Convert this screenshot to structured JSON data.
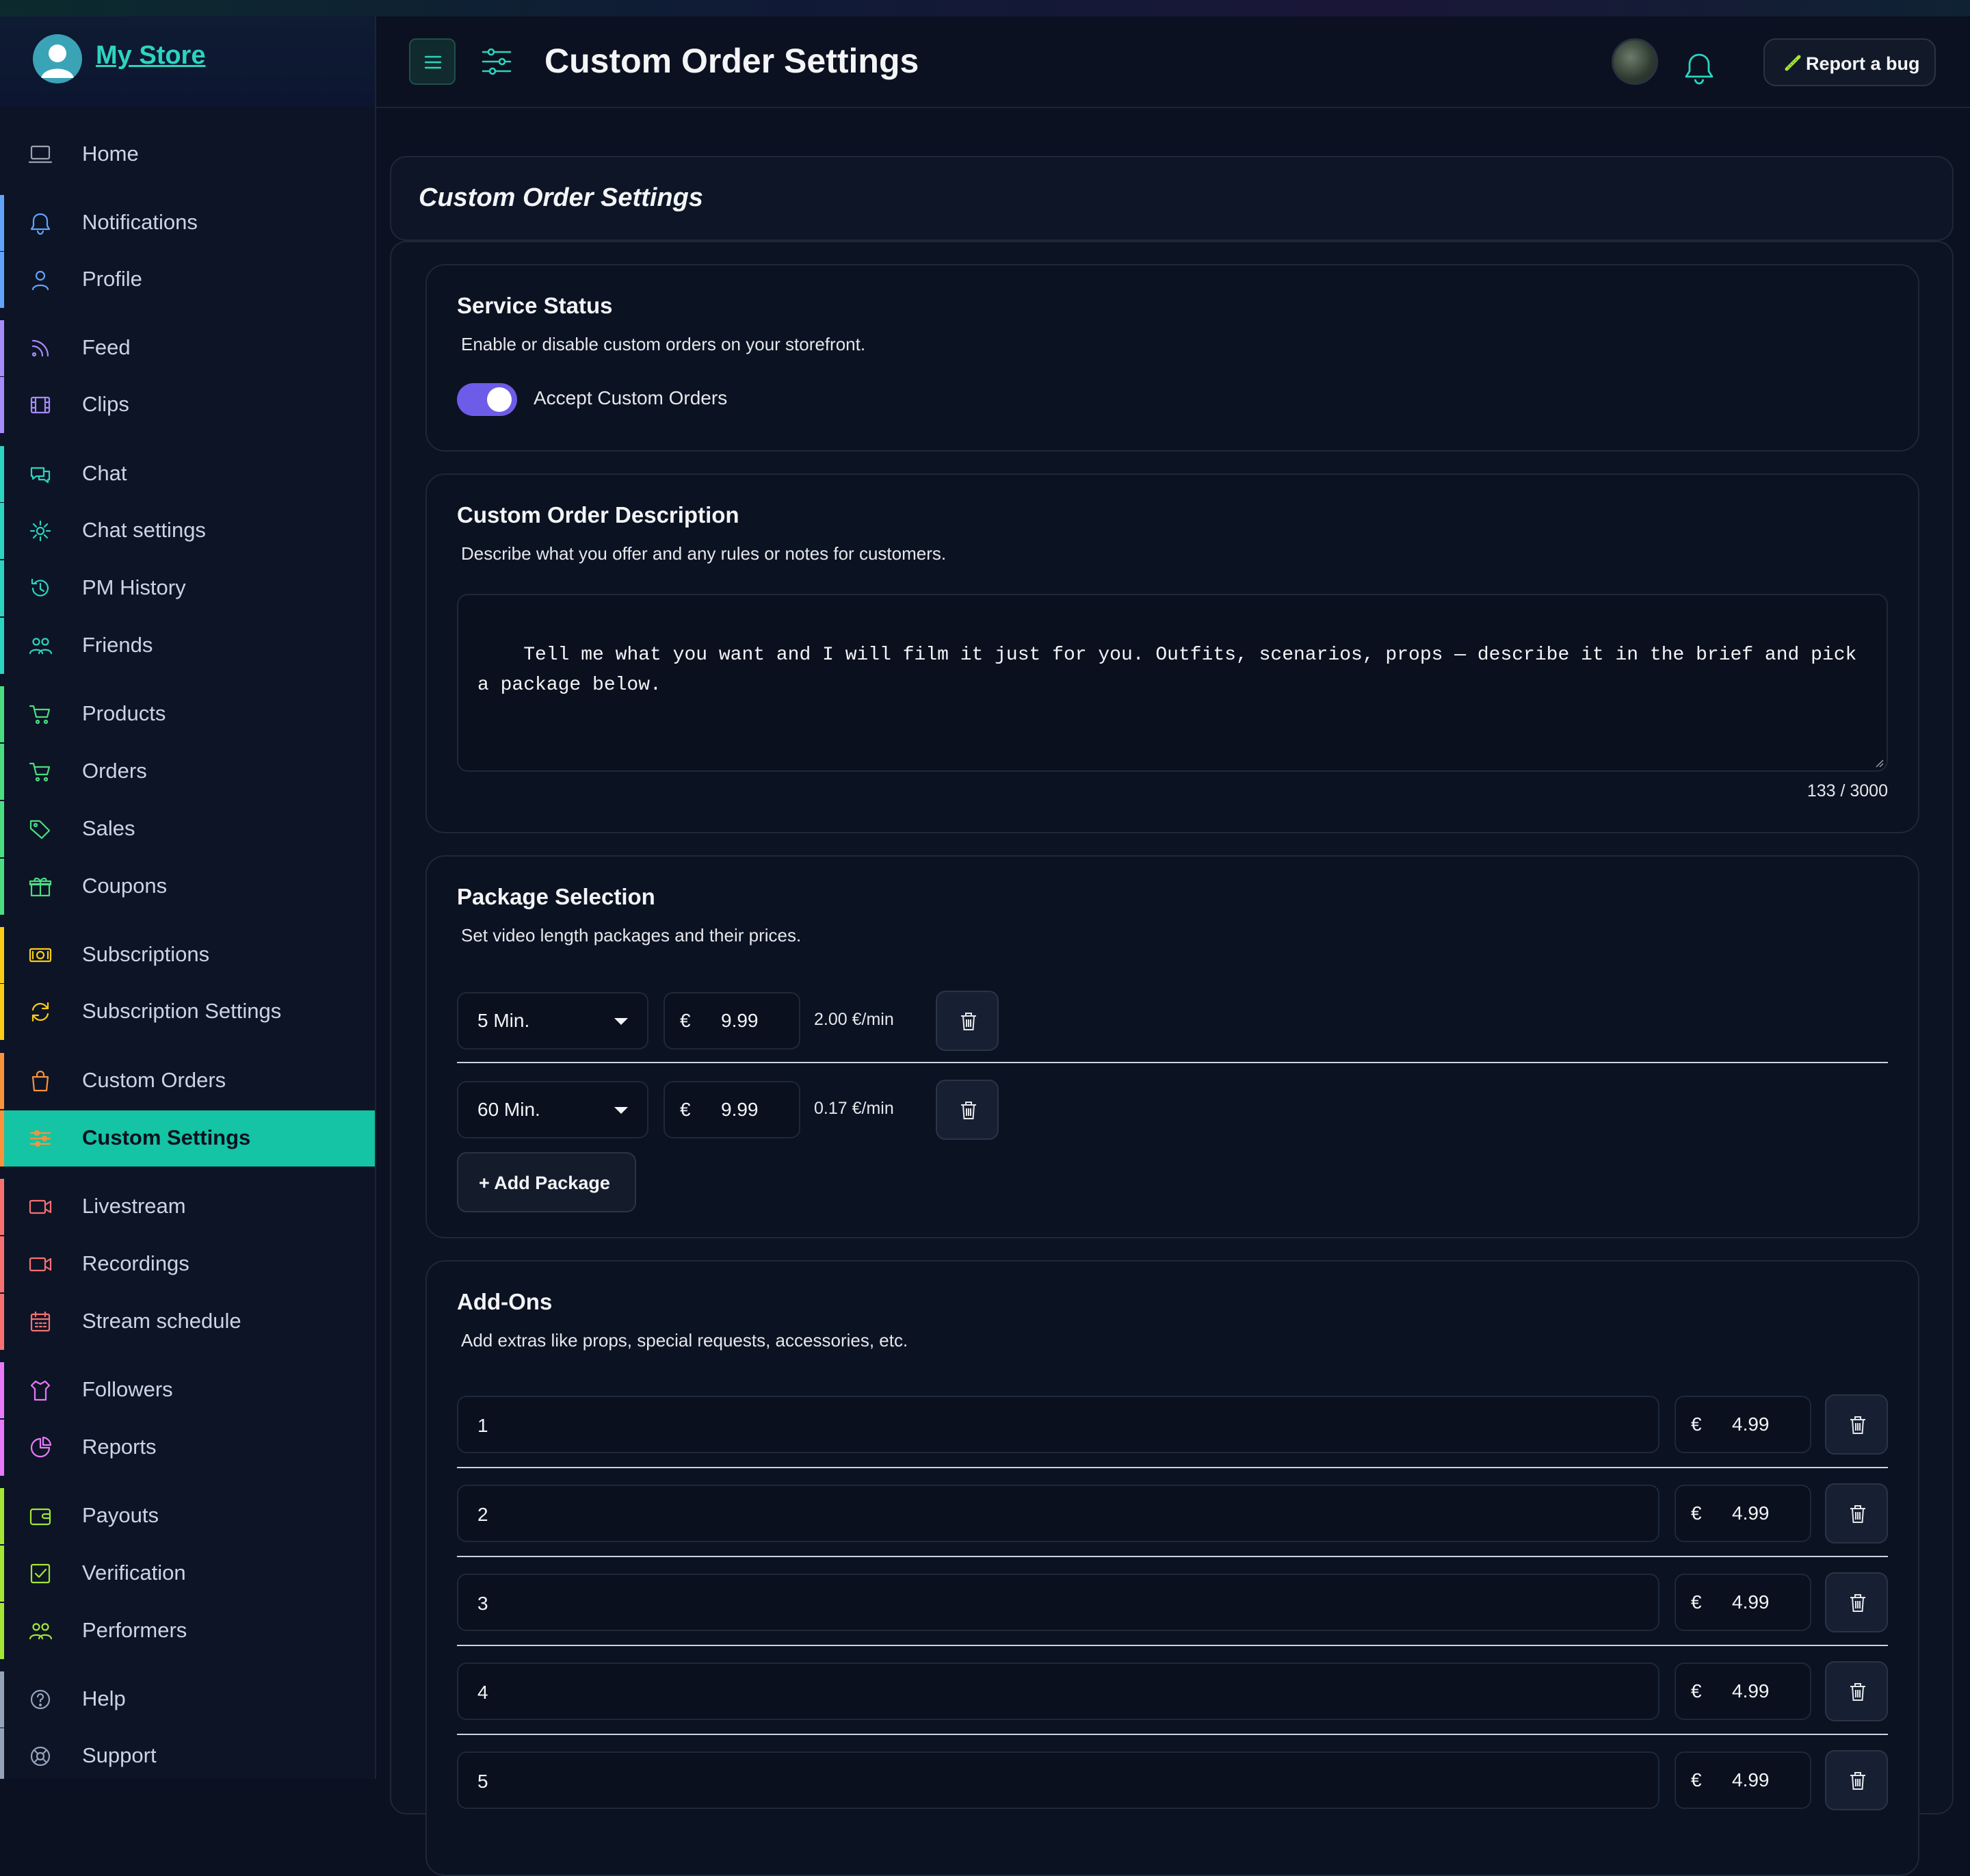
{
  "brand": {
    "name": "My Store"
  },
  "sidebar": {
    "items": [
      {
        "label": "Home",
        "icon": "laptop-icon",
        "color": "#9ca3af",
        "active": false
      },
      {
        "label": "Notifications",
        "icon": "bell-icon",
        "color": "#60a5fa",
        "active": false
      },
      {
        "label": "Profile",
        "icon": "user-icon",
        "color": "#60a5fa",
        "active": false
      },
      {
        "label": "Feed",
        "icon": "rss-icon",
        "color": "#a78bfa",
        "active": false
      },
      {
        "label": "Clips",
        "icon": "film-icon",
        "color": "#a78bfa",
        "active": false
      },
      {
        "label": "Chat",
        "icon": "chat-icon",
        "color": "#2dd4bf",
        "active": false
      },
      {
        "label": "Chat settings",
        "icon": "gear-icon",
        "color": "#2dd4bf",
        "active": false
      },
      {
        "label": "PM History",
        "icon": "history-icon",
        "color": "#2dd4bf",
        "active": false
      },
      {
        "label": "Friends",
        "icon": "users-icon",
        "color": "#2dd4bf",
        "active": false
      },
      {
        "label": "Products",
        "icon": "cart-icon",
        "color": "#4ade80",
        "active": false
      },
      {
        "label": "Orders",
        "icon": "cart-icon",
        "color": "#4ade80",
        "active": false
      },
      {
        "label": "Sales",
        "icon": "tags-icon",
        "color": "#4ade80",
        "active": false
      },
      {
        "label": "Coupons",
        "icon": "gift-icon",
        "color": "#4ade80",
        "active": false
      },
      {
        "label": "Subscriptions",
        "icon": "money-icon",
        "color": "#facc15",
        "active": false
      },
      {
        "label": "Subscription Settings",
        "icon": "refresh-icon",
        "color": "#facc15",
        "active": false
      },
      {
        "label": "Custom Orders",
        "icon": "bag-icon",
        "color": "#fb923c",
        "active": false
      },
      {
        "label": "Custom Settings",
        "icon": "sliders-icon",
        "color": "#fb923c",
        "active": true
      },
      {
        "label": "Livestream",
        "icon": "video-icon",
        "color": "#f87171",
        "active": false
      },
      {
        "label": "Recordings",
        "icon": "video-icon",
        "color": "#f87171",
        "active": false
      },
      {
        "label": "Stream schedule",
        "icon": "calendar-icon",
        "color": "#f87171",
        "active": false
      },
      {
        "label": "Followers",
        "icon": "shirt-icon",
        "color": "#e879f9",
        "active": false
      },
      {
        "label": "Reports",
        "icon": "pie-chart-icon",
        "color": "#e879f9",
        "active": false
      },
      {
        "label": "Payouts",
        "icon": "wallet-icon",
        "color": "#a3e635",
        "active": false
      },
      {
        "label": "Verification",
        "icon": "check-square-icon",
        "color": "#a3e635",
        "active": false
      },
      {
        "label": "Performers",
        "icon": "users-icon",
        "color": "#a3e635",
        "active": false
      },
      {
        "label": "Help",
        "icon": "help-icon",
        "color": "#94a3b8",
        "active": false
      },
      {
        "label": "Support",
        "icon": "lifebuoy-icon",
        "color": "#94a3b8",
        "active": false
      }
    ]
  },
  "header": {
    "title": "Custom Order Settings",
    "report_label": "Report a bug"
  },
  "page": {
    "card_title": "Custom Order Settings"
  },
  "service": {
    "title": "Service Status",
    "desc": "Enable or disable custom orders on your storefront.",
    "toggle_label": "Accept Custom Orders",
    "enabled": true
  },
  "description": {
    "title": "Custom Order Description",
    "desc": "Describe what you offer and any rules or notes for customers.",
    "text": "Tell me what you want and I will film it just for you. Outfits, scenarios, props — describe it in the brief and pick a package below.",
    "counter": "133 / 3000"
  },
  "packages": {
    "title": "Package Selection",
    "desc": "Set video length packages and their prices.",
    "currency": "€",
    "add_label": "Add Package",
    "rows": [
      {
        "duration": "5 Min.",
        "price": "9.99",
        "rate": "2.00 €/min"
      },
      {
        "duration": "60 Min.",
        "price": "9.99",
        "rate": "0.17 €/min"
      }
    ]
  },
  "addons": {
    "title": "Add-Ons",
    "desc": "Add extras like props, special requests, accessories, etc.",
    "currency": "€",
    "rows": [
      {
        "name": "1",
        "price": "4.99"
      },
      {
        "name": "2",
        "price": "4.99"
      },
      {
        "name": "3",
        "price": "4.99"
      },
      {
        "name": "4",
        "price": "4.99"
      },
      {
        "name": "5",
        "price": "4.99"
      }
    ]
  },
  "colors": {
    "accent": "#14c4a4",
    "toggle": "#6d5ce8",
    "brand_link": "#2dd4bf"
  }
}
